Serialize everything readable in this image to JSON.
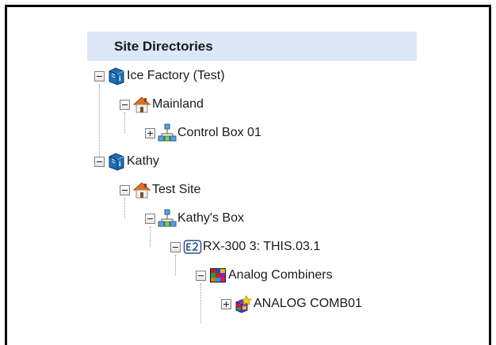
{
  "panel": {
    "title": "Site Directories"
  },
  "tree": [
    {
      "label": "Ice Factory (Test)",
      "icon": "book-icon",
      "toggle": "minus"
    },
    {
      "label": "Mainland",
      "icon": "house-icon",
      "toggle": "minus"
    },
    {
      "label": "Control Box 01",
      "icon": "network-icon",
      "toggle": "plus"
    },
    {
      "label": "Kathy",
      "icon": "book-icon",
      "toggle": "minus"
    },
    {
      "label": "Test Site",
      "icon": "house-icon",
      "toggle": "minus"
    },
    {
      "label": "Kathy's Box",
      "icon": "network-icon",
      "toggle": "minus"
    },
    {
      "label": "RX-300 3: THIS.03.1",
      "icon": "e2-controller-icon",
      "toggle": "minus"
    },
    {
      "label": "Analog Combiners",
      "icon": "cube-group-icon",
      "toggle": "minus"
    },
    {
      "label": "ANALOG COMB01",
      "icon": "cube-item-icon",
      "toggle": "plus"
    }
  ],
  "colors": {
    "header_bg": "#dce8f8",
    "book_blue": "#1f6fb0",
    "house_orange": "#e07020"
  }
}
